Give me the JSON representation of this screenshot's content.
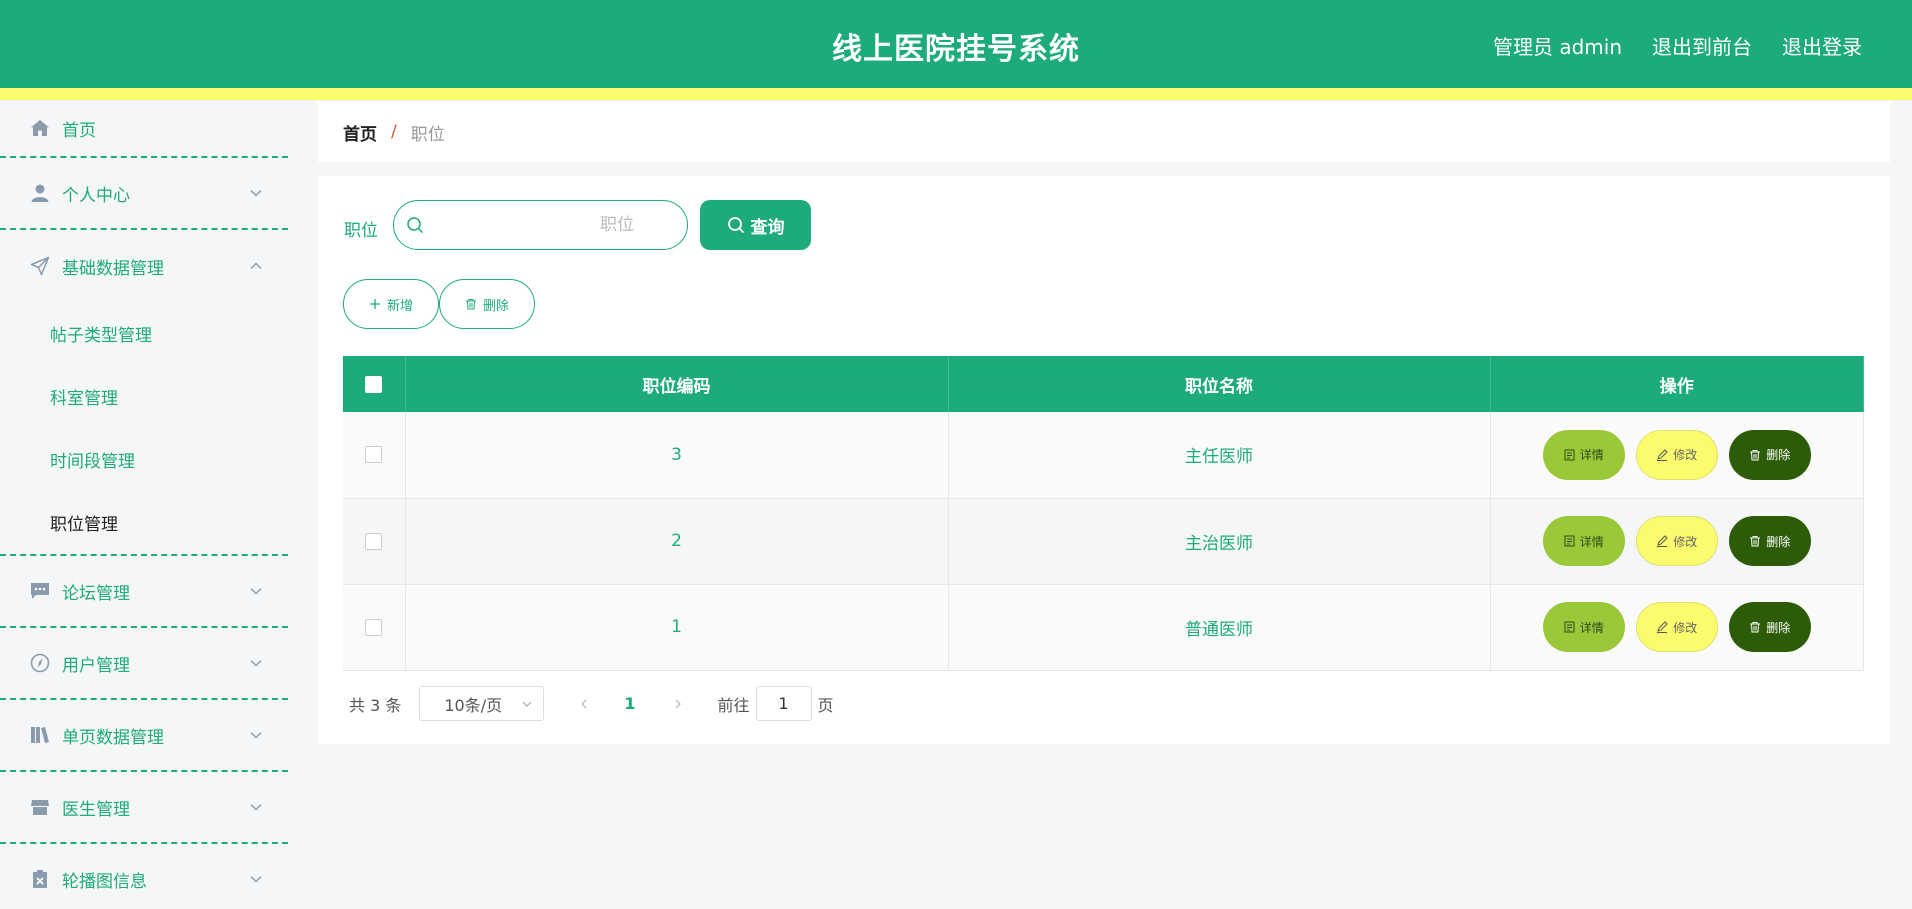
{
  "header": {
    "title": "线上医院挂号系统",
    "links": [
      "管理员 admin",
      "退出到前台",
      "退出登录"
    ]
  },
  "sidebar": {
    "items": [
      {
        "label": "首页",
        "icon": "home-icon"
      },
      {
        "label": "个人中心",
        "icon": "user-icon"
      },
      {
        "label": "基础数据管理",
        "icon": "send-icon",
        "expanded": true,
        "children": [
          "帖子类型管理",
          "科室管理",
          "时间段管理",
          "职位管理"
        ],
        "active_child": "职位管理"
      },
      {
        "label": "论坛管理",
        "icon": "chat-icon"
      },
      {
        "label": "用户管理",
        "icon": "compass-icon"
      },
      {
        "label": "单页数据管理",
        "icon": "book-icon"
      },
      {
        "label": "医生管理",
        "icon": "shop-icon"
      },
      {
        "label": "轮播图信息",
        "icon": "clipboard-icon"
      }
    ]
  },
  "breadcrumb": {
    "home": "首页",
    "separator": "/",
    "current": "职位"
  },
  "search": {
    "label": "职位",
    "placeholder": "职位",
    "button": "查询"
  },
  "actions": {
    "add": "新增",
    "delete": "删除"
  },
  "table": {
    "columns": [
      "职位编码",
      "职位名称",
      "操作"
    ],
    "rows": [
      {
        "code": "3",
        "name": "主任医师"
      },
      {
        "code": "2",
        "name": "主治医师"
      },
      {
        "code": "1",
        "name": "普通医师"
      }
    ],
    "row_actions": {
      "detail": "详情",
      "edit": "修改",
      "delete": "删除"
    }
  },
  "pagination": {
    "total": "共 3 条",
    "page_size": "10条/页",
    "current_page": "1",
    "goto_label": "前往",
    "goto_value": "1",
    "page_suffix": "页"
  },
  "colors": {
    "primary": "#1dab7b",
    "yellow": "#fbfb6e",
    "detail": "#9ac838",
    "danger": "#2c5c08"
  }
}
